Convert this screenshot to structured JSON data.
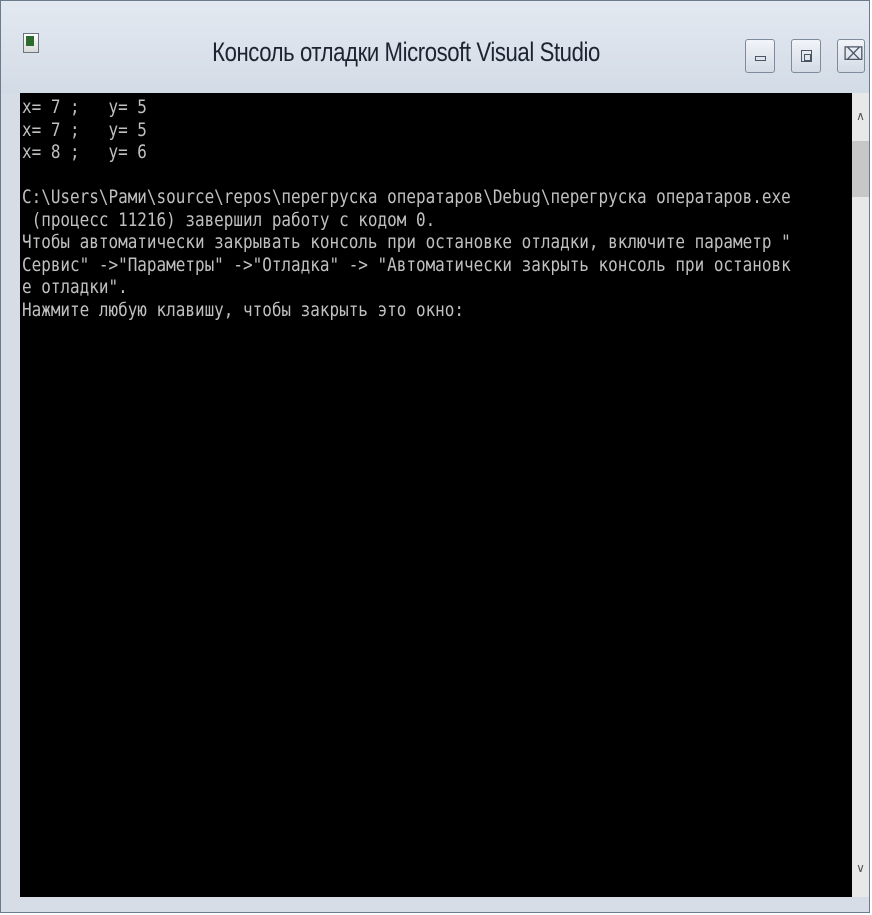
{
  "window": {
    "title": "Консоль отладки Microsoft Visual Studio",
    "icon": "console-app-icon"
  },
  "controls": {
    "minimize_icon": "minimize-icon",
    "maximize_icon": "maximize-icon",
    "close_icon": "close-icon",
    "close_glyph": "⌧"
  },
  "console": {
    "lines": [
      "x= 7 ;   y= 5",
      "x= 7 ;   y= 5",
      "x= 8 ;   y= 6",
      "",
      "C:\\Users\\Рами\\source\\repos\\перегрyска оператаров\\Debug\\перегрyска оператаров.exe",
      " (процесс 11216) завершил работу с кодом 0.",
      "Чтобы автоматически закрывать консоль при остановке отладки, включите параметр \"",
      "Сервис\" ->\"Параметры\" ->\"Отладка\" -> \"Автоматически закрыть консоль при остановк",
      "е отладки\".",
      "Нажмите любую клавишу, чтобы закрыть это окно:"
    ]
  },
  "scrollbar": {
    "up_glyph": "∧",
    "down_glyph": "∨"
  }
}
